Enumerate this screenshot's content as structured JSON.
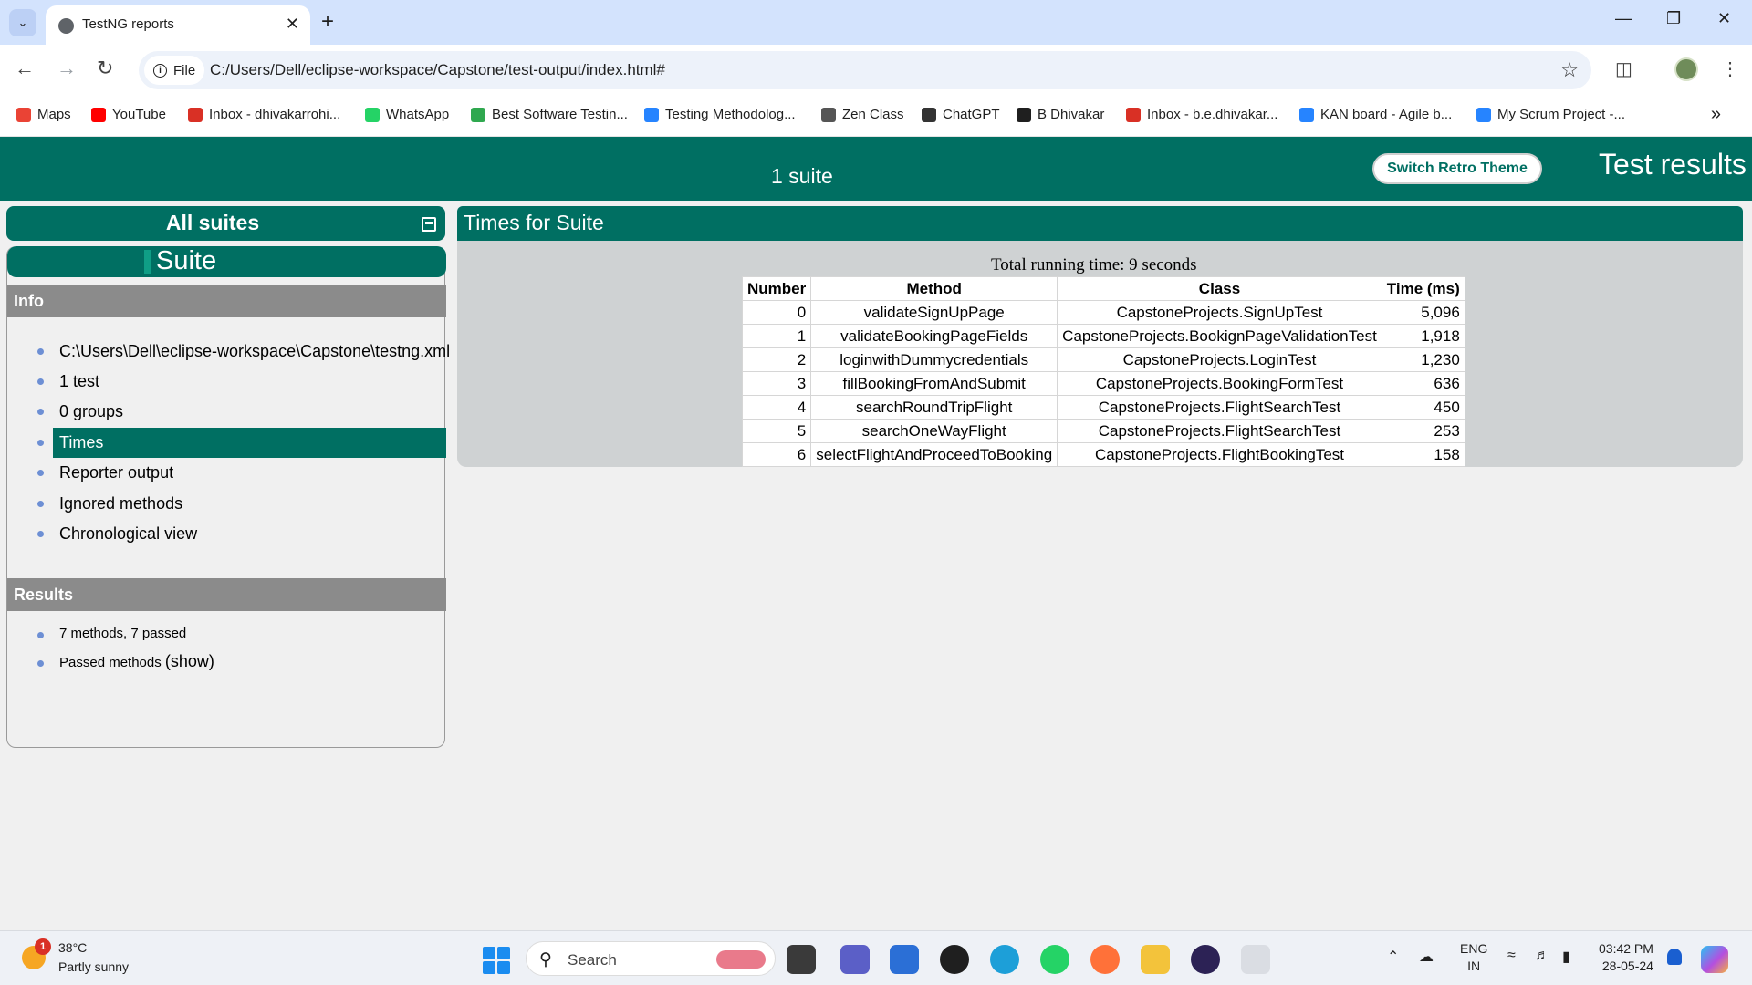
{
  "browser": {
    "tab_title": "TestNG reports",
    "url_scheme_label": "File",
    "url": "C:/Users/Dell/eclipse-workspace/Capstone/test-output/index.html#",
    "bookmarks": [
      {
        "label": "Maps",
        "icon": "maps-pin-icon",
        "color": "#ea4335"
      },
      {
        "label": "YouTube",
        "icon": "youtube-icon",
        "color": "#ff0000"
      },
      {
        "label": "Inbox - dhivakarrohi...",
        "icon": "gmail-icon",
        "color": "#d93025"
      },
      {
        "label": "WhatsApp",
        "icon": "whatsapp-icon",
        "color": "#25d366"
      },
      {
        "label": "Best Software Testin...",
        "icon": "site-8-icon",
        "color": "#2fa84f"
      },
      {
        "label": "Testing Methodolog...",
        "icon": "jira-diamond-icon",
        "color": "#2684ff"
      },
      {
        "label": "Zen Class",
        "icon": "zen-class-icon",
        "color": "#555555"
      },
      {
        "label": "ChatGPT",
        "icon": "chatgpt-icon",
        "color": "#333333"
      },
      {
        "label": "B Dhivakar",
        "icon": "github-icon",
        "color": "#1f1f1f"
      },
      {
        "label": "Inbox - b.e.dhivakar...",
        "icon": "gmail-icon",
        "color": "#d93025"
      },
      {
        "label": "KAN board - Agile b...",
        "icon": "jira-diamond-icon",
        "color": "#2684ff"
      },
      {
        "label": "My Scrum Project -...",
        "icon": "jira-diamond-icon",
        "color": "#2684ff"
      }
    ]
  },
  "report": {
    "suite_count": "1 suite",
    "retro_button": "Switch Retro Theme",
    "title": "Test results",
    "all_suites": "All suites",
    "suite_name": "Suite",
    "info_heading": "Info",
    "info_items": [
      "C:\\Users\\Dell\\eclipse-workspace\\Capstone\\testng.xml",
      "1 test",
      "0 groups",
      "Times",
      "Reporter output",
      "Ignored methods",
      "Chronological view"
    ],
    "active_item": "Times",
    "results_heading": "Results",
    "results_summary": "7 methods, 7 passed",
    "passed_methods": "Passed methods",
    "show_link": "(show)",
    "times_heading": "Times for Suite",
    "total_running_time": "Total running time: 9 seconds",
    "table": {
      "headers": [
        "Number",
        "Method",
        "Class",
        "Time (ms)"
      ],
      "rows": [
        [
          "0",
          "validateSignUpPage",
          "CapstoneProjects.SignUpTest",
          "5,096"
        ],
        [
          "1",
          "validateBookingPageFields",
          "CapstoneProjects.BookignPageValidationTest",
          "1,918"
        ],
        [
          "2",
          "loginwithDummycredentials",
          "CapstoneProjects.LoginTest",
          "1,230"
        ],
        [
          "3",
          "fillBookingFromAndSubmit",
          "CapstoneProjects.BookingFormTest",
          "636"
        ],
        [
          "4",
          "searchRoundTripFlight",
          "CapstoneProjects.FlightSearchTest",
          "450"
        ],
        [
          "5",
          "searchOneWayFlight",
          "CapstoneProjects.FlightSearchTest",
          "253"
        ],
        [
          "6",
          "selectFlightAndProceedToBooking",
          "CapstoneProjects.FlightBookingTest",
          "158"
        ]
      ]
    }
  },
  "colors": {
    "brand": "#006f62",
    "section_gray": "#8b8b8b",
    "bullet": "#6d8fd4"
  },
  "taskbar": {
    "weather_badge": "1",
    "temperature": "38°C",
    "weather": "Partly sunny",
    "search_label": "Search",
    "lang_top": "ENG",
    "lang_bottom": "IN",
    "time": "03:42 PM",
    "date": "28-05-24"
  }
}
